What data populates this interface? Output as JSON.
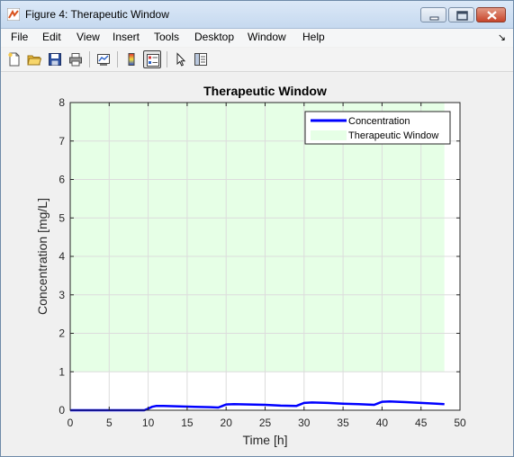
{
  "window": {
    "title": "Figure 4: Therapeutic Window",
    "icon": "matlab-figure-icon",
    "controls": [
      "minimize-icon",
      "maximize-icon",
      "close-icon"
    ]
  },
  "menubar": {
    "items": [
      {
        "label": "File"
      },
      {
        "label": "Edit"
      },
      {
        "label": "View"
      },
      {
        "label": "Insert"
      },
      {
        "label": "Tools"
      },
      {
        "label": "Desktop"
      },
      {
        "label": "Window"
      },
      {
        "label": "Help"
      }
    ],
    "overflow_glyph": "↘"
  },
  "toolbar": {
    "buttons": [
      {
        "name": "new-figure-icon"
      },
      {
        "name": "open-file-icon"
      },
      {
        "name": "save-icon"
      },
      {
        "name": "print-icon"
      },
      {
        "name": "link-plot-icon"
      },
      {
        "name": "insert-colorbar-icon"
      },
      {
        "name": "insert-legend-icon",
        "active": true
      },
      {
        "name": "edit-plot-icon"
      },
      {
        "name": "property-inspector-icon"
      }
    ]
  },
  "chart_data": {
    "type": "line",
    "title": "Therapeutic Window",
    "xlabel": "Time [h]",
    "ylabel": "Concentration [mg/L]",
    "xlim": [
      0,
      50
    ],
    "ylim": [
      0,
      8
    ],
    "xticks": [
      0,
      5,
      10,
      15,
      20,
      25,
      30,
      35,
      40,
      45,
      50
    ],
    "yticks": [
      0,
      1,
      2,
      3,
      4,
      5,
      6,
      7,
      8
    ],
    "grid": true,
    "legend_position": "top-right",
    "colors": {
      "concentration": "#0000ff",
      "window_fill": "#e6ffe6",
      "axes": "#262626",
      "grid": "#dcdcdc"
    },
    "series": [
      {
        "name": "Concentration",
        "x": [
          0,
          9.5,
          10,
          10.5,
          11,
          12,
          14,
          16,
          18,
          19,
          19.5,
          20,
          21,
          23,
          25,
          27,
          29,
          29.5,
          30,
          31,
          33,
          35,
          37,
          39,
          39.5,
          40,
          41,
          43,
          45,
          47,
          48
        ],
        "y": [
          0,
          0,
          0.04,
          0.09,
          0.11,
          0.11,
          0.1,
          0.09,
          0.08,
          0.07,
          0.11,
          0.15,
          0.16,
          0.15,
          0.14,
          0.12,
          0.11,
          0.15,
          0.19,
          0.2,
          0.19,
          0.17,
          0.16,
          0.14,
          0.18,
          0.22,
          0.23,
          0.21,
          0.19,
          0.17,
          0.16
        ]
      }
    ],
    "regions": [
      {
        "name": "Therapeutic Window",
        "x": [
          0,
          48
        ],
        "y": [
          1,
          8
        ]
      }
    ]
  }
}
